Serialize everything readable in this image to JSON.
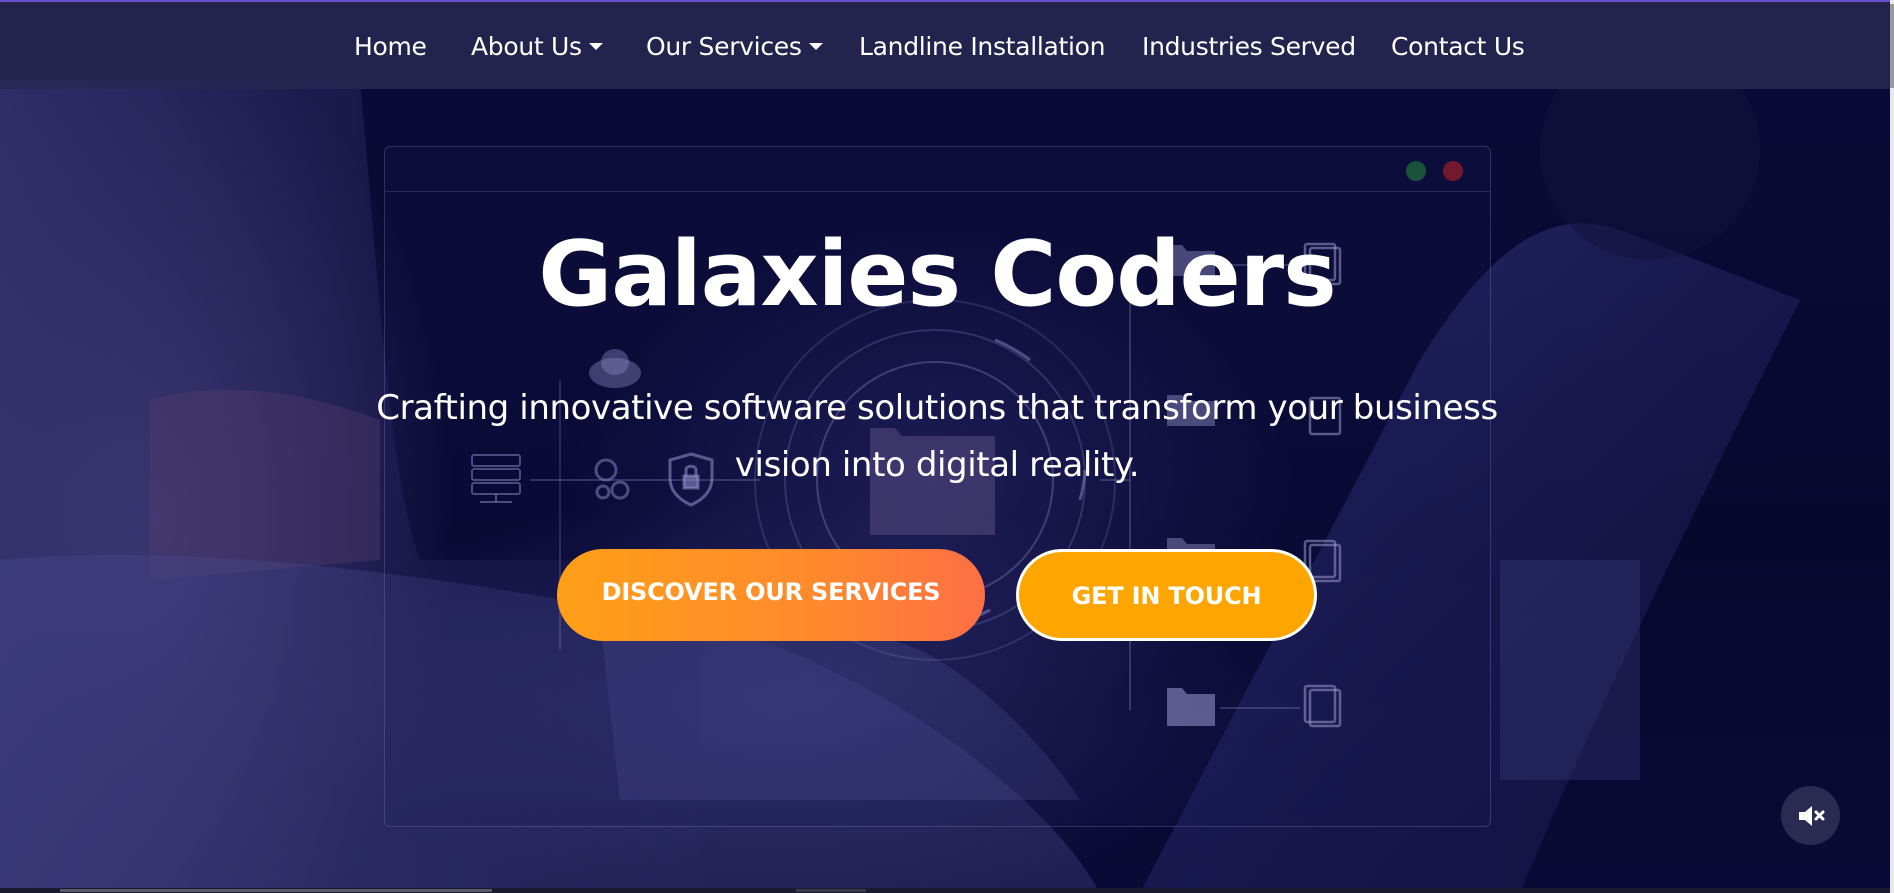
{
  "nav": {
    "items": [
      {
        "label": "Home",
        "has_dropdown": false
      },
      {
        "label": "About Us",
        "has_dropdown": true
      },
      {
        "label": "Our Services",
        "has_dropdown": true
      },
      {
        "label": "Landline Installation",
        "has_dropdown": false
      },
      {
        "label": "Industries Served",
        "has_dropdown": false
      },
      {
        "label": "Contact Us",
        "has_dropdown": false
      }
    ]
  },
  "hero": {
    "title": "Galaxies Coders",
    "subtitle": "Crafting innovative software solutions that transform your business vision into digital reality.",
    "primary_button": "DISCOVER OUR SERVICES",
    "secondary_button": "GET IN TOUCH"
  },
  "colors": {
    "navbar_bg": "#28284f",
    "accent_orange": "#ffa500",
    "gradient_start": "#ff9f17",
    "gradient_end": "#ff6e45",
    "text": "#ffffff"
  },
  "icons": {
    "mute": "volume-mute-icon",
    "dropdown": "caret-down-icon",
    "decor": [
      "server-icon",
      "gears-icon",
      "shield-lock-icon",
      "cloud-icon",
      "folder-icon",
      "document-icon"
    ]
  }
}
